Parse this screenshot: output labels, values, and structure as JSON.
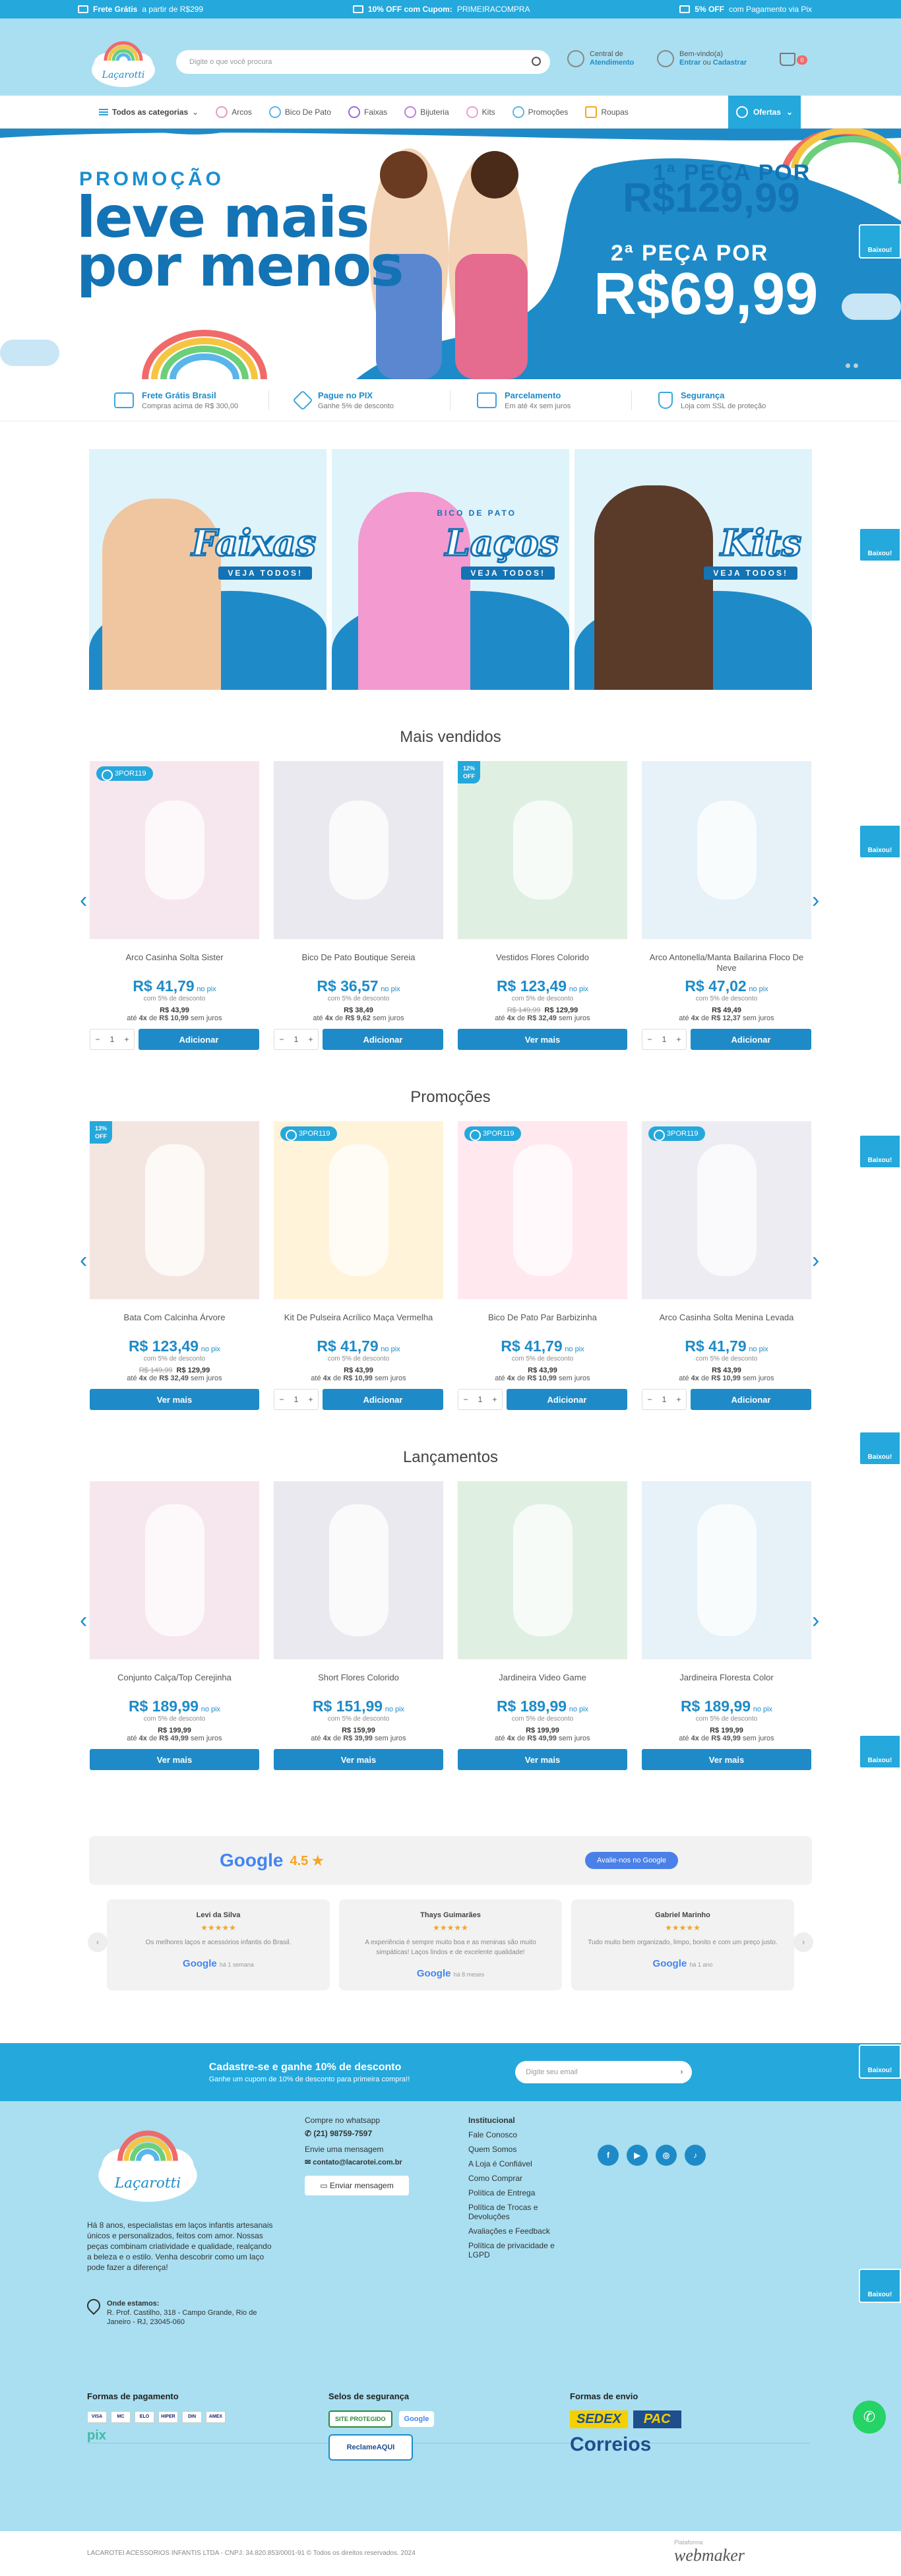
{
  "topbar": {
    "frete_bold": "Frete Grátis",
    "frete_text": "a partir de R$299",
    "cupom_bold": "10% OFF com Cupom:",
    "cupom_code": "PRIMEIRACOMPRA",
    "pix_bold": "5% OFF",
    "pix_text": "com Pagamento via Pix"
  },
  "header": {
    "logo_text": "Laçarotti",
    "search_placeholder": "Digite o que você procura",
    "atendimento_top": "Central de",
    "atendimento_bottom": "Atendimento",
    "account_top": "Bem-vindo(a)",
    "account_enter": "Entrar",
    "account_or": "ou",
    "account_register": "Cadastrar",
    "cart_count": "0"
  },
  "nav": {
    "all": "Todos as categorias",
    "items": [
      "Arcos",
      "Bico De Pato",
      "Faixas",
      "Bijuteria",
      "Kits",
      "Promoções",
      "Roupas"
    ],
    "ofertas": "Ofertas"
  },
  "hero": {
    "line1": "PROMOÇÃO",
    "line2": "leve mais",
    "line3": "por menos",
    "first_label": "1ª PEÇA POR",
    "first_price": "R$129,99",
    "second_label": "2ª PEÇA POR",
    "second_price": "R$69,99"
  },
  "baixou": "Baixou!",
  "benefits": [
    {
      "title": "Frete Grátis Brasil",
      "sub": "Compras acima de R$ 300,00"
    },
    {
      "title": "Pague no PIX",
      "sub": "Ganhe 5% de desconto"
    },
    {
      "title": "Parcelamento",
      "sub": "Em até 4x sem juros"
    },
    {
      "title": "Segurança",
      "sub": "Loja com SSL de proteção"
    }
  ],
  "categories": [
    {
      "title": "Faixas",
      "sub": "",
      "cta": "VEJA TODOS!"
    },
    {
      "title": "Laços",
      "sub": "BICO DE PATO",
      "cta": "VEJA TODOS!"
    },
    {
      "title": "Kits",
      "sub": "",
      "cta": "VEJA TODOS!"
    }
  ],
  "sections": [
    {
      "title": "Mais vendidos",
      "products": [
        {
          "badge": "3POR119",
          "off": "",
          "name": "Arco Casinha Solta Sister",
          "price": "R$ 41,79",
          "pix": "no pix",
          "pix_note": "com 5% de desconto",
          "old": "",
          "full": "R$ 43,99",
          "inst_n": "4x",
          "inst_v": "R$ 10,99",
          "inst_tail": "sem juros",
          "qty": "1",
          "btn": "Adicionar"
        },
        {
          "badge": "",
          "off": "",
          "name": "Bico De Pato Boutique Sereia",
          "price": "R$ 36,57",
          "pix": "no pix",
          "pix_note": "com 5% de desconto",
          "old": "",
          "full": "R$ 38,49",
          "inst_n": "4x",
          "inst_v": "R$ 9,62",
          "inst_tail": "sem juros",
          "qty": "1",
          "btn": "Adicionar"
        },
        {
          "badge": "",
          "off": "12% OFF",
          "name": "Vestidos Flores Colorido",
          "price": "R$ 123,49",
          "pix": "no pix",
          "pix_note": "com 5% de desconto",
          "old": "R$ 149,99",
          "full": "R$ 129,99",
          "inst_n": "4x",
          "inst_v": "R$ 32,49",
          "inst_tail": "sem juros",
          "qty": "",
          "btn": "Ver mais"
        },
        {
          "badge": "",
          "off": "",
          "name": "Arco Antonella/Manta Bailarina Floco De Neve",
          "price": "R$ 47,02",
          "pix": "no pix",
          "pix_note": "com 5% de desconto",
          "old": "",
          "full": "R$ 49,49",
          "inst_n": "4x",
          "inst_v": "R$ 12,37",
          "inst_tail": "sem juros",
          "qty": "1",
          "btn": "Adicionar"
        }
      ]
    },
    {
      "title": "Promoções",
      "products": [
        {
          "badge": "",
          "off": "13% OFF",
          "name": "Bata Com Calcinha Árvore",
          "price": "R$ 123,49",
          "pix": "no pix",
          "pix_note": "com 5% de desconto",
          "old": "R$ 149,99",
          "full": "R$ 129,99",
          "inst_n": "4x",
          "inst_v": "R$ 32,49",
          "inst_tail": "sem juros",
          "qty": "",
          "btn": "Ver mais"
        },
        {
          "badge": "3POR119",
          "off": "",
          "name": "Kit De Pulseira Acrílico Maça Vermelha",
          "price": "R$ 41,79",
          "pix": "no pix",
          "pix_note": "com 5% de desconto",
          "old": "",
          "full": "R$ 43,99",
          "inst_n": "4x",
          "inst_v": "R$ 10,99",
          "inst_tail": "sem juros",
          "qty": "1",
          "btn": "Adicionar"
        },
        {
          "badge": "3POR119",
          "off": "",
          "name": "Bico De Pato Par Barbizinha",
          "price": "R$ 41,79",
          "pix": "no pix",
          "pix_note": "com 5% de desconto",
          "old": "",
          "full": "R$ 43,99",
          "inst_n": "4x",
          "inst_v": "R$ 10,99",
          "inst_tail": "sem juros",
          "qty": "1",
          "btn": "Adicionar"
        },
        {
          "badge": "3POR119",
          "off": "",
          "name": "Arco Casinha Solta Menina Levada",
          "price": "R$ 41,79",
          "pix": "no pix",
          "pix_note": "com 5% de desconto",
          "old": "",
          "full": "R$ 43,99",
          "inst_n": "4x",
          "inst_v": "R$ 10,99",
          "inst_tail": "sem juros",
          "qty": "1",
          "btn": "Adicionar"
        }
      ]
    },
    {
      "title": "Lançamentos",
      "products": [
        {
          "badge": "",
          "off": "",
          "name": "Conjunto Calça/Top Cerejinha",
          "price": "R$ 189,99",
          "pix": "no pix",
          "pix_note": "com 5% de desconto",
          "old": "",
          "full": "R$ 199,99",
          "inst_n": "4x",
          "inst_v": "R$ 49,99",
          "inst_tail": "sem juros",
          "qty": "",
          "btn": "Ver mais"
        },
        {
          "badge": "",
          "off": "",
          "name": "Short Flores Colorido",
          "price": "R$ 151,99",
          "pix": "no pix",
          "pix_note": "com 5% de desconto",
          "old": "",
          "full": "R$ 159,99",
          "inst_n": "4x",
          "inst_v": "R$ 39,99",
          "inst_tail": "sem juros",
          "qty": "",
          "btn": "Ver mais"
        },
        {
          "badge": "",
          "off": "",
          "name": "Jardineira Video Game",
          "price": "R$ 189,99",
          "pix": "no pix",
          "pix_note": "com 5% de desconto",
          "old": "",
          "full": "R$ 199,99",
          "inst_n": "4x",
          "inst_v": "R$ 49,99",
          "inst_tail": "sem juros",
          "qty": "",
          "btn": "Ver mais"
        },
        {
          "badge": "",
          "off": "",
          "name": "Jardineira Floresta Color",
          "price": "R$ 189,99",
          "pix": "no pix",
          "pix_note": "com 5% de desconto",
          "old": "",
          "full": "R$ 199,99",
          "inst_n": "4x",
          "inst_v": "R$ 49,99",
          "inst_tail": "sem juros",
          "qty": "",
          "btn": "Ver mais"
        }
      ]
    }
  ],
  "installment_prefix": "até",
  "installment_mid": "de",
  "reviews": {
    "google": "Google",
    "score": "4.5 ★",
    "cta": "Avalie-nos no Google",
    "items": [
      {
        "name": "Levi da Silva",
        "stars": "★★★★★",
        "text": "Os melhores laços e acessórios infantis do Brasil.",
        "time": "há 1 semana"
      },
      {
        "name": "Thays Guimarães",
        "stars": "★★★★★",
        "text": "A experiência é sempre muito boa e as meninas são muito simpáticas! Laços lindos e de excelente qualidade!",
        "time": "há 8 meses"
      },
      {
        "name": "Gabriel Marinho",
        "stars": "★★★★★",
        "text": "Tudo muito bem organizado, limpo, bonito e com um preço justo.",
        "time": "há 1 ano"
      }
    ]
  },
  "newsletter": {
    "title": "Cadastre-se e ganhe 10% de desconto",
    "sub": "Ganhe um cupom de 10% de desconto para primeira compra!!",
    "placeholder": "Digite seu email"
  },
  "footer": {
    "about": "Há 8 anos, especialistas em laços infantis artesanais únicos e personalizados, feitos com amor. Nossas peças combinam criatividade e qualidade, realçando a beleza e o estilo. Venha descobrir como um laço pode fazer a diferença!",
    "where_title": "Onde estamos:",
    "where_text": "R. Prof. Castilho, 318 - Campo Grande, Rio de Janeiro - RJ, 23045-060",
    "whatsapp_label": "Compre no whatsapp",
    "whatsapp_phone": "(21) 98759-7597",
    "msg_label": "Envie uma mensagem",
    "email": "contato@lacarotei.com.br",
    "send_btn": "Enviar mensagem",
    "inst_title": "Institucional",
    "inst_links": [
      "Fale Conosco",
      "Quem Somos",
      "A Loja é Confiável",
      "Como Comprar",
      "Política de Entrega",
      "Política de Trocas e Devoluções",
      "Avaliações e Feedback",
      "Política de privacidade e LGPD"
    ],
    "pay_title": "Formas de pagamento",
    "pay_items": [
      "VISA",
      "MC",
      "ELO",
      "HIPER",
      "DIN",
      "AMEX"
    ],
    "pix": "pix",
    "sec_title": "Selos de segurança",
    "seal1": "SITE PROTEGIDO",
    "seal2": "Google",
    "seal3": "ReclameAQUI",
    "ship_title": "Formas de envio",
    "sedex": "SEDEX",
    "pac": "PAC",
    "correios": "Correios",
    "copyright": "LACAROTEI ACESSORIOS INFANTIS LTDA - CNPJ: 34.820.853/0001-91 © Todos os direitos reservados. 2024",
    "platform_label": "Plataforma",
    "platform": "webmaker"
  }
}
